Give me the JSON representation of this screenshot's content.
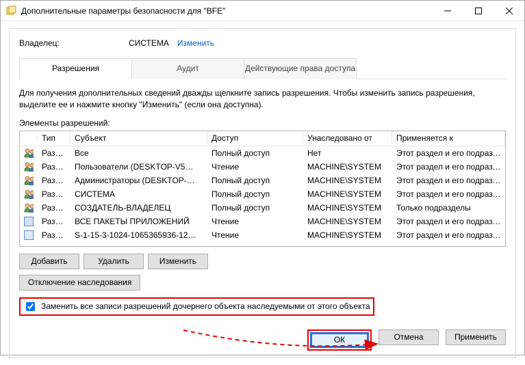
{
  "title": "Дополнительные параметры безопасности  для \"BFE\"",
  "owner": {
    "label": "Владелец:",
    "value": "СИСТЕМА",
    "change": "Изменить"
  },
  "tabs": {
    "permissions": "Разрешения",
    "audit": "Аудит",
    "effective": "Действующие права доступа"
  },
  "desc": "Для получения дополнительных сведений дважды щелкните запись разрешения. Чтобы изменить запись разрешения, выделите ее и нажмите кнопку \"Изменить\" (если она доступна).",
  "list_label": "Элементы разрешений:",
  "columns": {
    "type": "Тип",
    "subject": "Субъект",
    "access": "Доступ",
    "inherited": "Унаследовано от",
    "applies": "Применяется к"
  },
  "rows": [
    {
      "icon": "users",
      "type": "Разр…",
      "subject": "Все",
      "access": "Полный доступ",
      "inherited": "Нет",
      "applies": "Этот раздел и его подразделы"
    },
    {
      "icon": "users",
      "type": "Разр…",
      "subject": "Пользователи (DESKTOP-V5…",
      "access": "Чтение",
      "inherited": "MACHINE\\SYSTEM",
      "applies": "Этот раздел и его подразделы"
    },
    {
      "icon": "users",
      "type": "Разр…",
      "subject": "Администраторы (DESKTOP-…",
      "access": "Полный доступ",
      "inherited": "MACHINE\\SYSTEM",
      "applies": "Этот раздел и его подразделы"
    },
    {
      "icon": "users",
      "type": "Разр…",
      "subject": "СИСТЕМА",
      "access": "Полный доступ",
      "inherited": "MACHINE\\SYSTEM",
      "applies": "Этот раздел и его подразделы"
    },
    {
      "icon": "users",
      "type": "Разр…",
      "subject": "СОЗДАТЕЛЬ-ВЛАДЕЛЕЦ",
      "access": "Полный доступ",
      "inherited": "MACHINE\\SYSTEM",
      "applies": "Только подразделы"
    },
    {
      "icon": "pkg",
      "type": "Разр…",
      "subject": "ВСЕ ПАКЕТЫ ПРИЛОЖЕНИЙ",
      "access": "Чтение",
      "inherited": "MACHINE\\SYSTEM",
      "applies": "Этот раздел и его подразделы"
    },
    {
      "icon": "sid",
      "type": "Разр…",
      "subject": "S-1-15-3-1024-1065365936-12…",
      "access": "Чтение",
      "inherited": "MACHINE\\SYSTEM",
      "applies": "Этот раздел и его подразделы"
    }
  ],
  "buttons": {
    "add": "Добавить",
    "remove": "Удалить",
    "edit": "Изменить",
    "disable_inh": "Отключение наследования",
    "ok": "ОК",
    "cancel": "Отмена",
    "apply": "Применить"
  },
  "checkbox_label": "Заменить все записи разрешений дочернего объекта наследуемыми от этого объекта"
}
